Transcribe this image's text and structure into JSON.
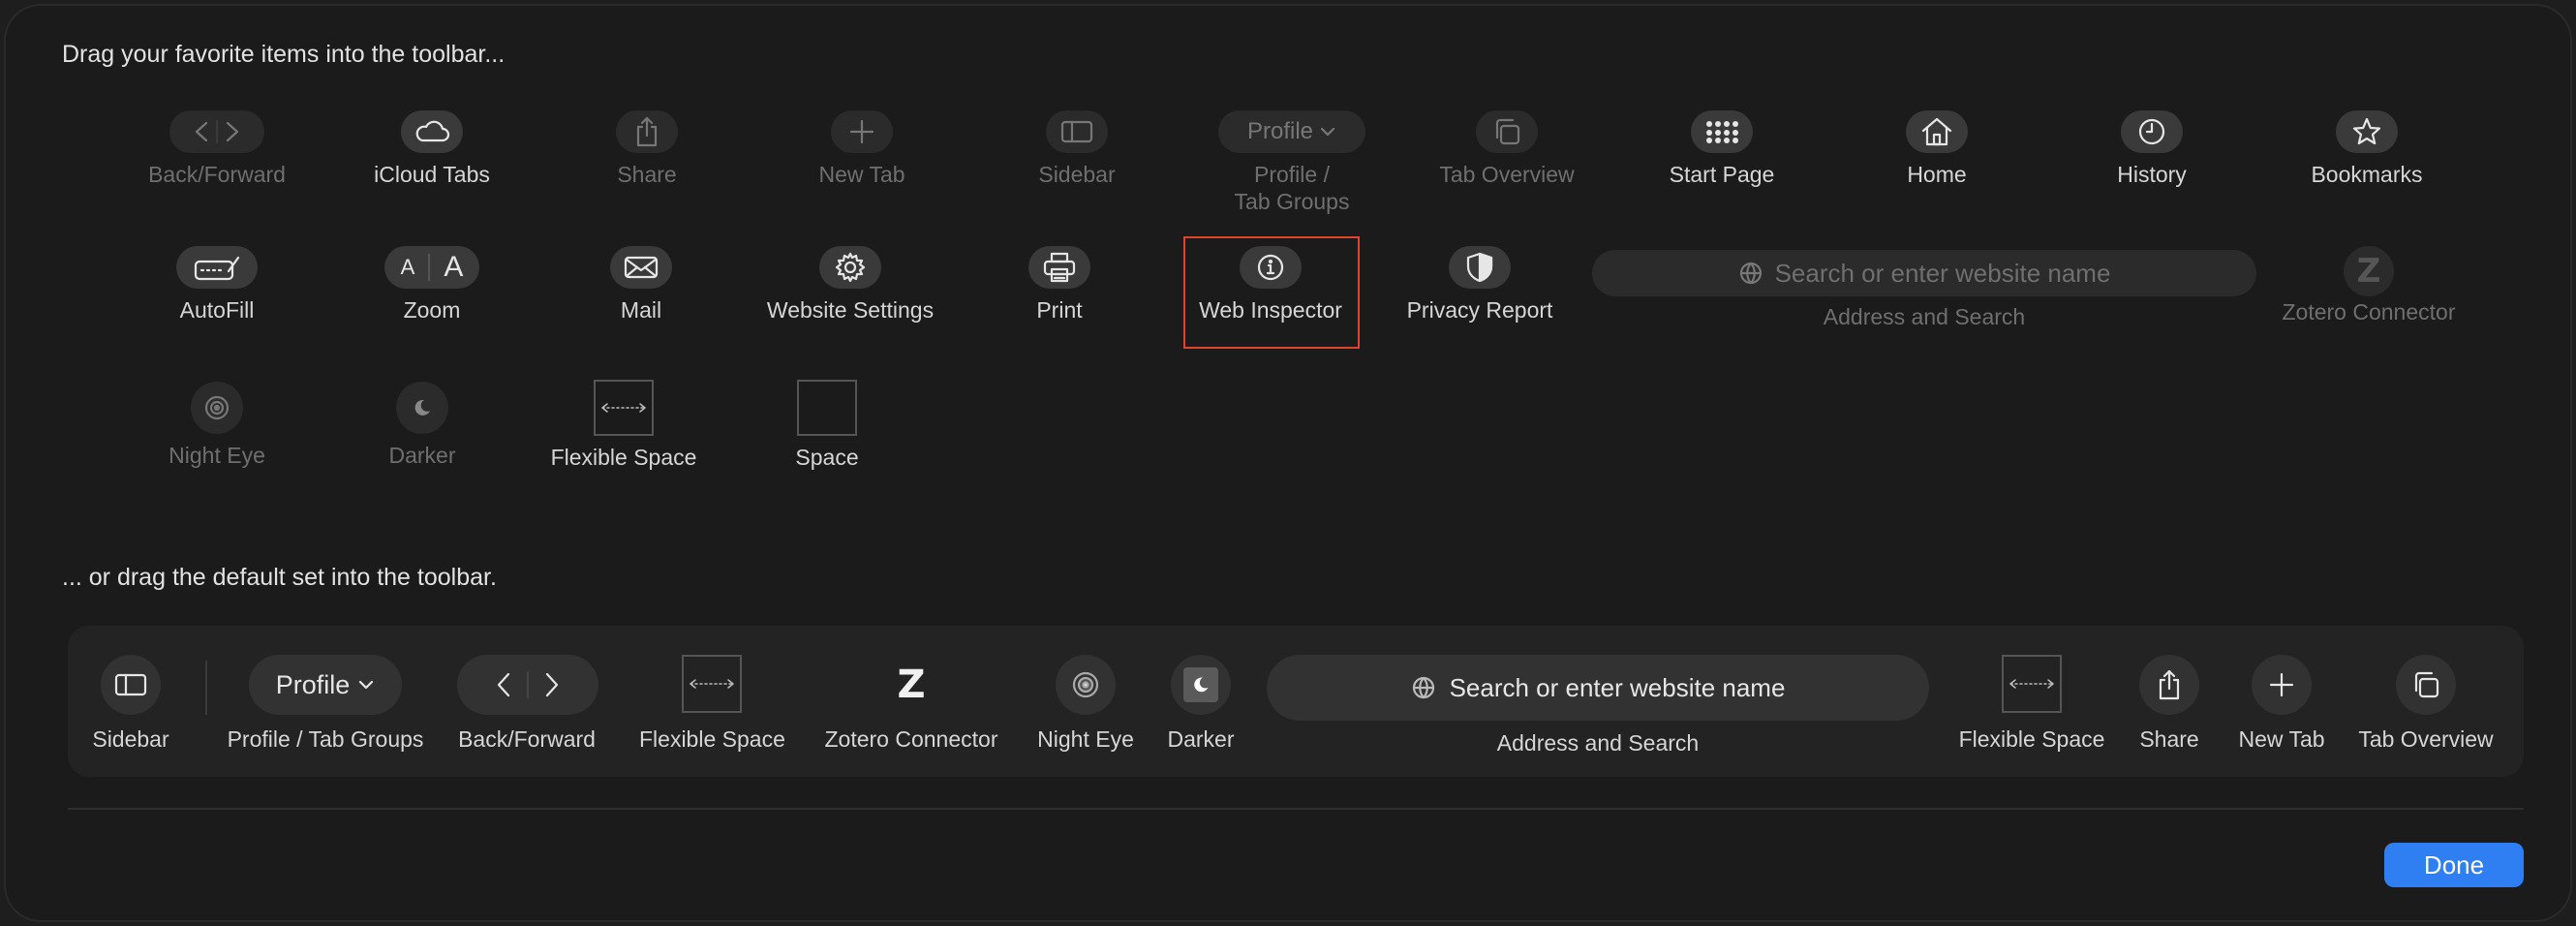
{
  "headings": {
    "favorites": "Drag your favorite items into the toolbar...",
    "default_set": "... or drag the default set into the toolbar."
  },
  "palette": {
    "row1": [
      {
        "label": "Back/Forward",
        "icon": "back-forward-icon",
        "dim": true
      },
      {
        "label": "iCloud Tabs",
        "icon": "cloud-icon",
        "dim": false
      },
      {
        "label": "Share",
        "icon": "share-icon",
        "dim": true
      },
      {
        "label": "New Tab",
        "icon": "plus-icon",
        "dim": true
      },
      {
        "label": "Sidebar",
        "icon": "sidebar-icon",
        "dim": true
      },
      {
        "label": "Profile /",
        "label2": "Tab Groups",
        "cap_text": "Profile",
        "icon": "chevron-down-icon",
        "dim": true
      },
      {
        "label": "Tab Overview",
        "icon": "tab-overview-icon",
        "dim": true
      },
      {
        "label": "Start Page",
        "icon": "grid-icon",
        "dim": false
      },
      {
        "label": "Home",
        "icon": "home-icon",
        "dim": false
      },
      {
        "label": "History",
        "icon": "clock-icon",
        "dim": false
      },
      {
        "label": "Bookmarks",
        "icon": "star-icon",
        "dim": false
      }
    ],
    "row2": [
      {
        "label": "AutoFill",
        "icon": "autofill-icon",
        "dim": false
      },
      {
        "label": "Zoom",
        "icon": "zoom-icon",
        "cap_text": "A A",
        "dim": false
      },
      {
        "label": "Mail",
        "icon": "mail-icon",
        "dim": false
      },
      {
        "label": "Website Settings",
        "icon": "gear-icon",
        "dim": false
      },
      {
        "label": "Print",
        "icon": "printer-icon",
        "dim": false
      },
      {
        "label": "Web Inspector",
        "icon": "info-icon",
        "dim": false
      },
      {
        "label": "Privacy Report",
        "icon": "shield-icon",
        "dim": false
      },
      {
        "label": "Zotero Connector",
        "icon": "zotero-icon",
        "cap_text": "Z",
        "dim": true
      }
    ],
    "row3": [
      {
        "label": "Night Eye",
        "icon": "eye-icon",
        "dim": true
      },
      {
        "label": "Darker",
        "icon": "moon-icon",
        "dim": true
      },
      {
        "label": "Flexible Space",
        "icon": "flexible-space-icon",
        "dim": false
      },
      {
        "label": "Space",
        "icon": "space-icon",
        "dim": false
      }
    ],
    "address": {
      "placeholder": "Search or enter website name",
      "label": "Address and Search"
    }
  },
  "default_set": {
    "items": [
      {
        "label": "Sidebar",
        "icon": "sidebar-icon"
      },
      {
        "label": "Profile / Tab Groups",
        "cap_text": "Profile",
        "icon": "chevron-down-icon"
      },
      {
        "label": "Back/Forward",
        "icon": "back-forward-icon"
      },
      {
        "label": "Flexible Space",
        "icon": "flexible-space-icon"
      },
      {
        "label": "Zotero Connector",
        "icon": "zotero-icon",
        "cap_text": "Z"
      },
      {
        "label": "Night Eye",
        "icon": "eye-icon"
      },
      {
        "label": "Darker",
        "icon": "moon-icon"
      },
      {
        "label": "Flexible Space",
        "icon": "flexible-space-icon"
      },
      {
        "label": "Share",
        "icon": "share-icon"
      },
      {
        "label": "New Tab",
        "icon": "plus-icon"
      },
      {
        "label": "Tab Overview",
        "icon": "tab-overview-icon"
      }
    ],
    "address": {
      "placeholder": "Search or enter website name",
      "label": "Address and Search"
    }
  },
  "done_label": "Done",
  "colors": {
    "accent": "#2f7ff3",
    "highlight": "#e0442f",
    "background": "#1b1b1b"
  }
}
